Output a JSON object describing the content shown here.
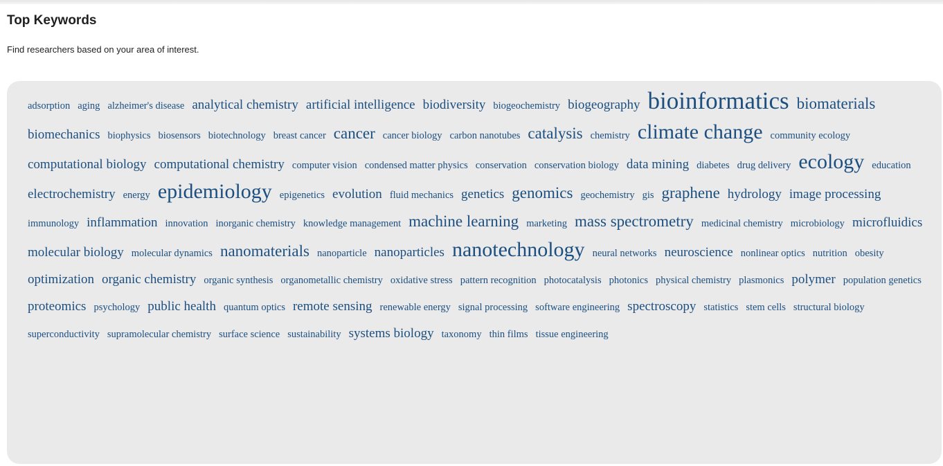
{
  "header": {
    "title": "Top Keywords",
    "subtitle": "Find researchers based on your area of interest."
  },
  "colors": {
    "keyword_link": "#1c4f80",
    "cloud_background": "#eaeaea",
    "heading_text": "#1f1f1f"
  },
  "keywords": [
    {
      "text": "adsorption",
      "weight": 1
    },
    {
      "text": "aging",
      "weight": 1
    },
    {
      "text": "alzheimer's disease",
      "weight": 1
    },
    {
      "text": "analytical chemistry",
      "weight": 2
    },
    {
      "text": "artificial intelligence",
      "weight": 2
    },
    {
      "text": "biodiversity",
      "weight": 2
    },
    {
      "text": "biogeochemistry",
      "weight": 1
    },
    {
      "text": "biogeography",
      "weight": 2
    },
    {
      "text": "bioinformatics",
      "weight": 5
    },
    {
      "text": "biomaterials",
      "weight": 3
    },
    {
      "text": "biomechanics",
      "weight": 2
    },
    {
      "text": "biophysics",
      "weight": 1
    },
    {
      "text": "biosensors",
      "weight": 1
    },
    {
      "text": "biotechnology",
      "weight": 1
    },
    {
      "text": "breast cancer",
      "weight": 1
    },
    {
      "text": "cancer",
      "weight": 3
    },
    {
      "text": "cancer biology",
      "weight": 1
    },
    {
      "text": "carbon nanotubes",
      "weight": 1
    },
    {
      "text": "catalysis",
      "weight": 3
    },
    {
      "text": "chemistry",
      "weight": 1
    },
    {
      "text": "climate change",
      "weight": 4
    },
    {
      "text": "community ecology",
      "weight": 1
    },
    {
      "text": "computational biology",
      "weight": 2
    },
    {
      "text": "computational chemistry",
      "weight": 2
    },
    {
      "text": "computer vision",
      "weight": 1
    },
    {
      "text": "condensed matter physics",
      "weight": 1
    },
    {
      "text": "conservation",
      "weight": 1
    },
    {
      "text": "conservation biology",
      "weight": 1
    },
    {
      "text": "data mining",
      "weight": 2
    },
    {
      "text": "diabetes",
      "weight": 1
    },
    {
      "text": "drug delivery",
      "weight": 1
    },
    {
      "text": "ecology",
      "weight": 4
    },
    {
      "text": "education",
      "weight": 1
    },
    {
      "text": "electrochemistry",
      "weight": 2
    },
    {
      "text": "energy",
      "weight": 1
    },
    {
      "text": "epidemiology",
      "weight": 4
    },
    {
      "text": "epigenetics",
      "weight": 1
    },
    {
      "text": "evolution",
      "weight": 2
    },
    {
      "text": "fluid mechanics",
      "weight": 1
    },
    {
      "text": "genetics",
      "weight": 2
    },
    {
      "text": "genomics",
      "weight": 3
    },
    {
      "text": "geochemistry",
      "weight": 1
    },
    {
      "text": "gis",
      "weight": 1
    },
    {
      "text": "graphene",
      "weight": 3
    },
    {
      "text": "hydrology",
      "weight": 2
    },
    {
      "text": "image processing",
      "weight": 2
    },
    {
      "text": "immunology",
      "weight": 1
    },
    {
      "text": "inflammation",
      "weight": 2
    },
    {
      "text": "innovation",
      "weight": 1
    },
    {
      "text": "inorganic chemistry",
      "weight": 1
    },
    {
      "text": "knowledge management",
      "weight": 1
    },
    {
      "text": "machine learning",
      "weight": 3
    },
    {
      "text": "marketing",
      "weight": 1
    },
    {
      "text": "mass spectrometry",
      "weight": 3
    },
    {
      "text": "medicinal chemistry",
      "weight": 1
    },
    {
      "text": "microbiology",
      "weight": 1
    },
    {
      "text": "microfluidics",
      "weight": 2
    },
    {
      "text": "molecular biology",
      "weight": 2
    },
    {
      "text": "molecular dynamics",
      "weight": 1
    },
    {
      "text": "nanomaterials",
      "weight": 3
    },
    {
      "text": "nanoparticle",
      "weight": 1
    },
    {
      "text": "nanoparticles",
      "weight": 2
    },
    {
      "text": "nanotechnology",
      "weight": 4
    },
    {
      "text": "neural networks",
      "weight": 1
    },
    {
      "text": "neuroscience",
      "weight": 2
    },
    {
      "text": "nonlinear optics",
      "weight": 1
    },
    {
      "text": "nutrition",
      "weight": 1
    },
    {
      "text": "obesity",
      "weight": 1
    },
    {
      "text": "optimization",
      "weight": 2
    },
    {
      "text": "organic chemistry",
      "weight": 2
    },
    {
      "text": "organic synthesis",
      "weight": 1
    },
    {
      "text": "organometallic chemistry",
      "weight": 1
    },
    {
      "text": "oxidative stress",
      "weight": 1
    },
    {
      "text": "pattern recognition",
      "weight": 1
    },
    {
      "text": "photocatalysis",
      "weight": 1
    },
    {
      "text": "photonics",
      "weight": 1
    },
    {
      "text": "physical chemistry",
      "weight": 1
    },
    {
      "text": "plasmonics",
      "weight": 1
    },
    {
      "text": "polymer",
      "weight": 2
    },
    {
      "text": "population genetics",
      "weight": 1
    },
    {
      "text": "proteomics",
      "weight": 2
    },
    {
      "text": "psychology",
      "weight": 1
    },
    {
      "text": "public health",
      "weight": 2
    },
    {
      "text": "quantum optics",
      "weight": 1
    },
    {
      "text": "remote sensing",
      "weight": 2
    },
    {
      "text": "renewable energy",
      "weight": 1
    },
    {
      "text": "signal processing",
      "weight": 1
    },
    {
      "text": "software engineering",
      "weight": 1
    },
    {
      "text": "spectroscopy",
      "weight": 2
    },
    {
      "text": "statistics",
      "weight": 1
    },
    {
      "text": "stem cells",
      "weight": 1
    },
    {
      "text": "structural biology",
      "weight": 1
    },
    {
      "text": "superconductivity",
      "weight": 1
    },
    {
      "text": "supramolecular chemistry",
      "weight": 1
    },
    {
      "text": "surface science",
      "weight": 1
    },
    {
      "text": "sustainability",
      "weight": 1
    },
    {
      "text": "systems biology",
      "weight": 2
    },
    {
      "text": "taxonomy",
      "weight": 1
    },
    {
      "text": "thin films",
      "weight": 1
    },
    {
      "text": "tissue engineering",
      "weight": 1
    }
  ]
}
